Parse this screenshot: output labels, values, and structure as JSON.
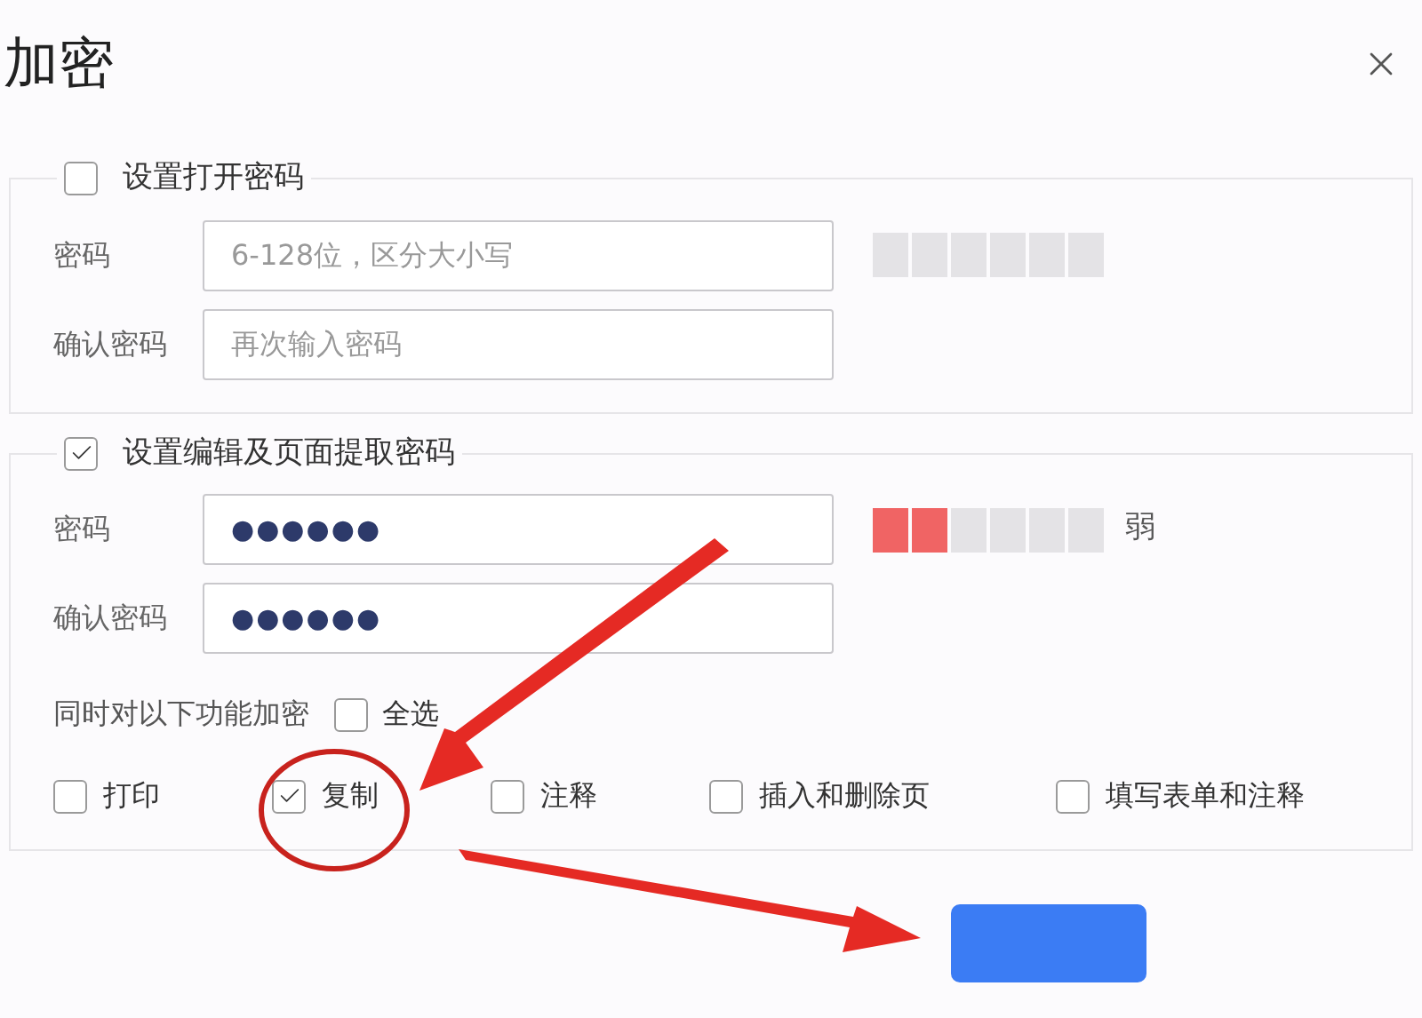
{
  "dialog": {
    "title": "加密"
  },
  "open_password": {
    "label": "设置打开密码",
    "checked": false,
    "fields": [
      {
        "label": "密码",
        "placeholder": "6-128位，区分大小写"
      },
      {
        "label": "确认密码",
        "placeholder": "再次输入密码"
      }
    ]
  },
  "edit_password": {
    "label": "设置编辑及页面提取密码",
    "checked": true,
    "fields": [
      {
        "label": "密码",
        "value": "●●●●●●"
      },
      {
        "label": "确认密码",
        "value": "●●●●●●"
      }
    ],
    "strength": {
      "level": 0.333,
      "reading": "弱"
    },
    "also_encrypt": "同时对以下功能加密",
    "select_all": {
      "label": "全选",
      "checked": false
    },
    "options": [
      {
        "label": "打印",
        "checked": false
      },
      {
        "label": "复制",
        "checked": true
      },
      {
        "label": "注释",
        "checked": false
      },
      {
        "label": "插入和删除页",
        "checked": false
      },
      {
        "label": "填写表单和注释",
        "checked": false
      }
    ]
  }
}
